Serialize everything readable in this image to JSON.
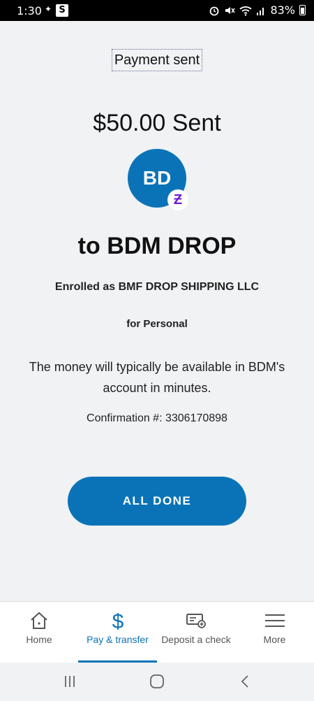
{
  "status_bar": {
    "time": "1:30",
    "battery": "83%"
  },
  "screen": {
    "title": "Payment sent",
    "amount_sent": "$50.00 Sent",
    "avatar_initials": "BD",
    "badge_letter": "Z",
    "recipient": "to BDM DROP",
    "enrolled_as": "Enrolled as BMF DROP SHIPPING LLC",
    "account_type": "for Personal",
    "message": "The money will typically be available in BDM's account in minutes.",
    "confirmation": "Confirmation #: 3306170898",
    "done_button": "ALL DONE"
  },
  "bottom_nav": {
    "items": [
      {
        "label": "Home",
        "icon": "home-icon"
      },
      {
        "label": "Pay & transfer",
        "icon": "dollar-icon",
        "active": true
      },
      {
        "label": "Deposit a check",
        "icon": "check-deposit-icon"
      },
      {
        "label": "More",
        "icon": "menu-icon"
      }
    ]
  },
  "colors": {
    "accent": "#0a73b8",
    "zelle": "#6d1ed4",
    "background": "#f1f2f4"
  }
}
